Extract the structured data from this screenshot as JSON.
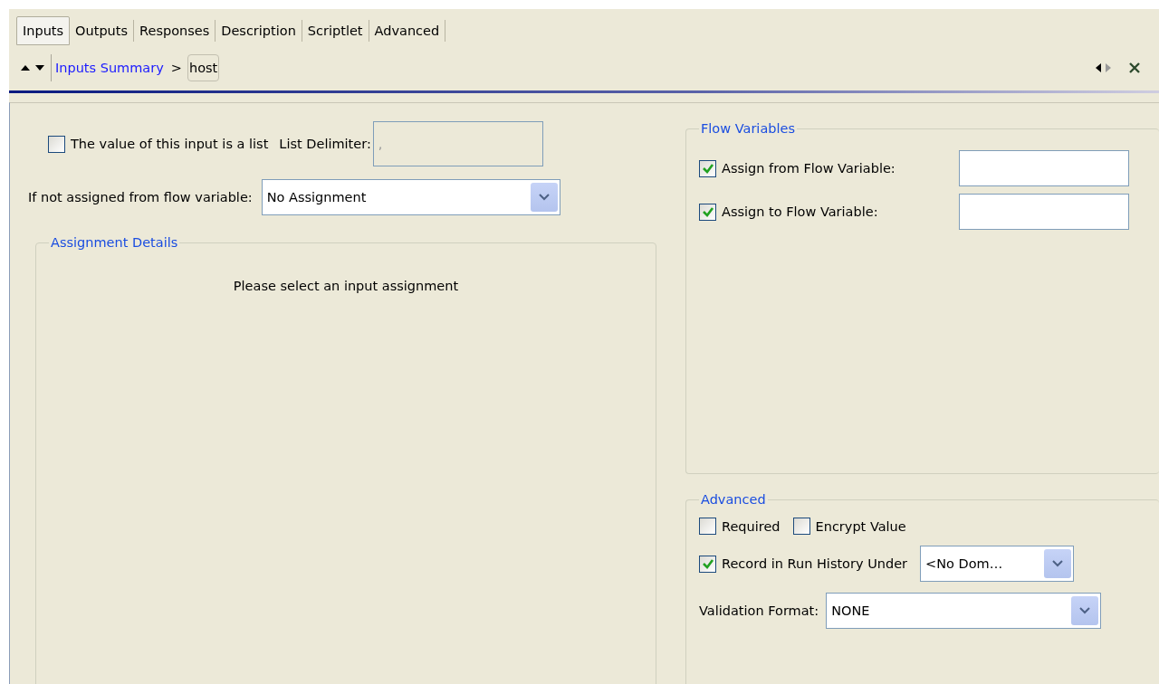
{
  "tabs": [
    {
      "label": "Inputs",
      "selected": true
    },
    {
      "label": "Outputs",
      "selected": false
    },
    {
      "label": "Responses",
      "selected": false
    },
    {
      "label": "Description",
      "selected": false
    },
    {
      "label": "Scriptlet",
      "selected": false
    },
    {
      "label": "Advanced",
      "selected": false
    }
  ],
  "breadcrumb": {
    "link": "Inputs Summary",
    "separator": ">",
    "current": "host"
  },
  "list_option": {
    "label": "The value of this input is a list",
    "checked": false
  },
  "list_delimiter": {
    "label": "List Delimiter:",
    "value": ",",
    "disabled": true
  },
  "fallback": {
    "label": "If not assigned from flow variable:",
    "value": "No Assignment"
  },
  "assignment_details": {
    "title": "Assignment Details",
    "message": "Please select an input assignment"
  },
  "flow_variables": {
    "title": "Flow Variables",
    "rows": [
      {
        "label": "Assign from Flow Variable:",
        "checked": true
      },
      {
        "label": "Assign to Flow Variable:",
        "checked": true
      }
    ]
  },
  "advanced": {
    "title": "Advanced",
    "options": [
      {
        "label": "Required",
        "checked": false
      },
      {
        "label": "Encrypt Value",
        "checked": false
      }
    ],
    "record": {
      "label": "Record in Run History Under",
      "checked": true,
      "value": "<No Dom…"
    },
    "validation": {
      "label": "Validation Format:",
      "value": "NONE"
    }
  }
}
